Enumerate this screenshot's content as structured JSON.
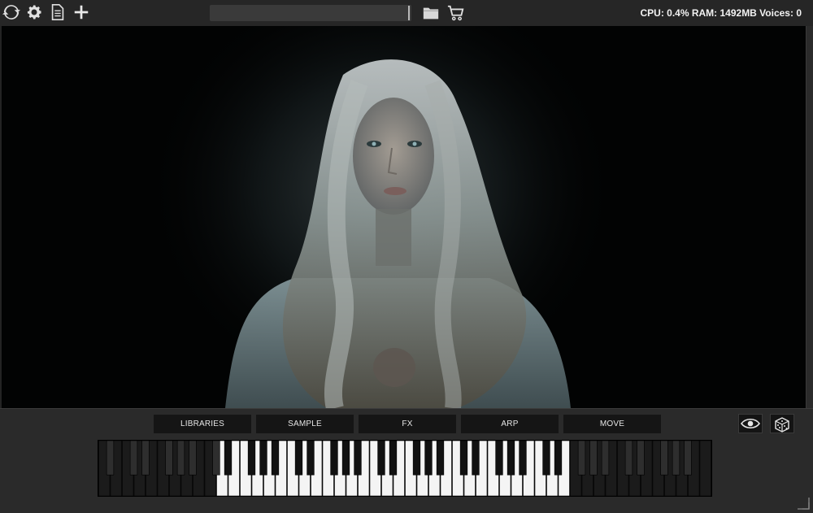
{
  "toolbar": {
    "icons": [
      "refresh-icon",
      "gear-icon",
      "document-icon",
      "plus-icon"
    ],
    "preset_name": "",
    "right_icons": [
      "folder-icon",
      "cart-icon"
    ]
  },
  "status": {
    "text": "CPU: 0.4% RAM: 1492MB Voices: 0"
  },
  "artwork": {
    "description_icon": "portrait-image"
  },
  "tabs": [
    "LIBRARIES",
    "SAMPLE",
    "FX",
    "ARP",
    "MOVE"
  ],
  "panel_buttons": [
    "eye-icon",
    "dice-icon"
  ],
  "keyboard": {
    "white_key_count": 52,
    "active_range_start_white": 10,
    "active_range_end_white": 39,
    "colors": {
      "active_white": "#f4f4f4",
      "inactive_white": "#1b1b1b",
      "active_black": "#111111",
      "inactive_black": "#0a0a0a"
    }
  },
  "colors": {
    "background": "#232323",
    "topbar": "#262626",
    "tab_bg": "#151515",
    "text": "#f2f2f2"
  }
}
